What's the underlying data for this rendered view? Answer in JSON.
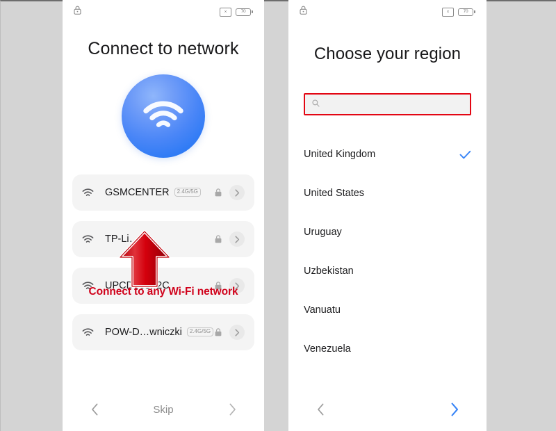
{
  "theme": {
    "page_background": "#d4d4d4",
    "panel_background": "#ffffff",
    "accent_blue": "#3a86f7",
    "annotation_red": "#d0021b",
    "highlight_red": "#e30613",
    "row_background": "#f4f4f4",
    "muted_text": "#8c8c8c"
  },
  "left_screen": {
    "status_bar": {
      "lock_icon": "lock-icon",
      "mute_icon": "mute-icon",
      "battery_icon": "battery-icon",
      "battery_level": "70"
    },
    "title": "Connect to network",
    "hero_icon": "wifi-orb-icon",
    "networks": [
      {
        "name": "GSMCENTER",
        "band": "2.4G/5G",
        "secured": true,
        "wifi_icon": "wifi-icon",
        "lock_icon": "lock-icon",
        "chevron_icon": "chevron-right-icon"
      },
      {
        "name": "TP-Li… 4",
        "band": "",
        "secured": true,
        "wifi_icon": "wifi-icon",
        "lock_icon": "lock-icon",
        "chevron_icon": "chevron-right-icon"
      },
      {
        "name": "UPCD863F2C",
        "band": "",
        "secured": true,
        "wifi_icon": "wifi-icon",
        "lock_icon": "lock-icon",
        "chevron_icon": "chevron-right-icon"
      },
      {
        "name": "POW-D…wniczki",
        "band": "2.4G/5G",
        "secured": true,
        "wifi_icon": "wifi-icon",
        "lock_icon": "lock-icon",
        "chevron_icon": "chevron-right-icon"
      }
    ],
    "annotation": {
      "text": "Connect to any Wi-Fi network",
      "arrow_icon": "red-up-arrow-icon"
    },
    "bottom_nav": {
      "back_icon": "chevron-left-icon",
      "center_label": "Skip",
      "next_icon": "chevron-right-icon",
      "next_enabled": false
    }
  },
  "right_screen": {
    "status_bar": {
      "lock_icon": "lock-icon",
      "mute_icon": "mute-icon",
      "battery_icon": "battery-icon",
      "battery_level": "70"
    },
    "title": "Choose your region",
    "search": {
      "icon": "search-icon",
      "value": "",
      "placeholder": "",
      "highlighted": true
    },
    "regions": [
      {
        "name": "United Kingdom",
        "selected": true
      },
      {
        "name": "United States",
        "selected": false
      },
      {
        "name": "Uruguay",
        "selected": false
      },
      {
        "name": "Uzbekistan",
        "selected": false
      },
      {
        "name": "Vanuatu",
        "selected": false
      },
      {
        "name": "Venezuela",
        "selected": false
      }
    ],
    "selected_check_icon": "check-icon",
    "bottom_nav": {
      "back_icon": "chevron-left-icon",
      "center_label": "",
      "next_icon": "chevron-right-icon",
      "next_enabled": true
    }
  }
}
